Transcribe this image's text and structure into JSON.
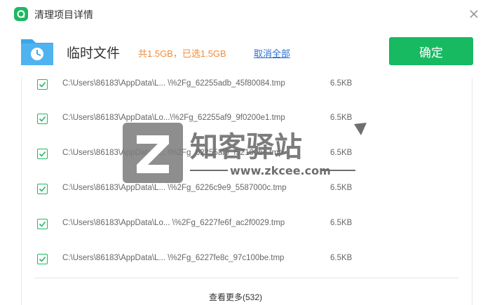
{
  "window": {
    "title": "清理项目详情",
    "close_icon": "close-icon",
    "app_icon": "app-logo-icon"
  },
  "header": {
    "category": "临时文件",
    "summary": "共1.5GB，已选1.5GB",
    "cancel_all": "取消全部",
    "confirm": "确定",
    "folder_icon": "clock-folder-icon"
  },
  "files": [
    {
      "path": "C:\\Users\\86183\\AppData\\L... \\%2Fg_62255adb_45f80084.tmp",
      "size": "6.5KB",
      "checked": true
    },
    {
      "path": "C:\\Users\\86183\\AppData\\Lo...\\%2Fg_62255af9_9f0200e1.tmp",
      "size": "6.5KB",
      "checked": true
    },
    {
      "path": "C:\\Users\\86183\\AppData\\L... \\%2Fg_62255af9_f52100be.tmp",
      "size": "6.5KB",
      "checked": true
    },
    {
      "path": "C:\\Users\\86183\\AppData\\L... \\%2Fg_6226c9e9_5587000c.tmp",
      "size": "6.5KB",
      "checked": true
    },
    {
      "path": "C:\\Users\\86183\\AppData\\Lo... \\%2Fg_6227fe6f_ac2f0029.tmp",
      "size": "6.5KB",
      "checked": true
    },
    {
      "path": "C:\\Users\\86183\\AppData\\L... \\%2Fg_6227fe8c_97c100be.tmp",
      "size": "6.5KB",
      "checked": true
    }
  ],
  "footer": {
    "see_more": "查看更多(532)"
  },
  "watermark": {
    "brand": "知客驿站",
    "url": "www.zkcee.com"
  },
  "colors": {
    "accent_green": "#17ba61",
    "summary_orange": "#f08c3b",
    "link_blue": "#2d6fd1"
  }
}
